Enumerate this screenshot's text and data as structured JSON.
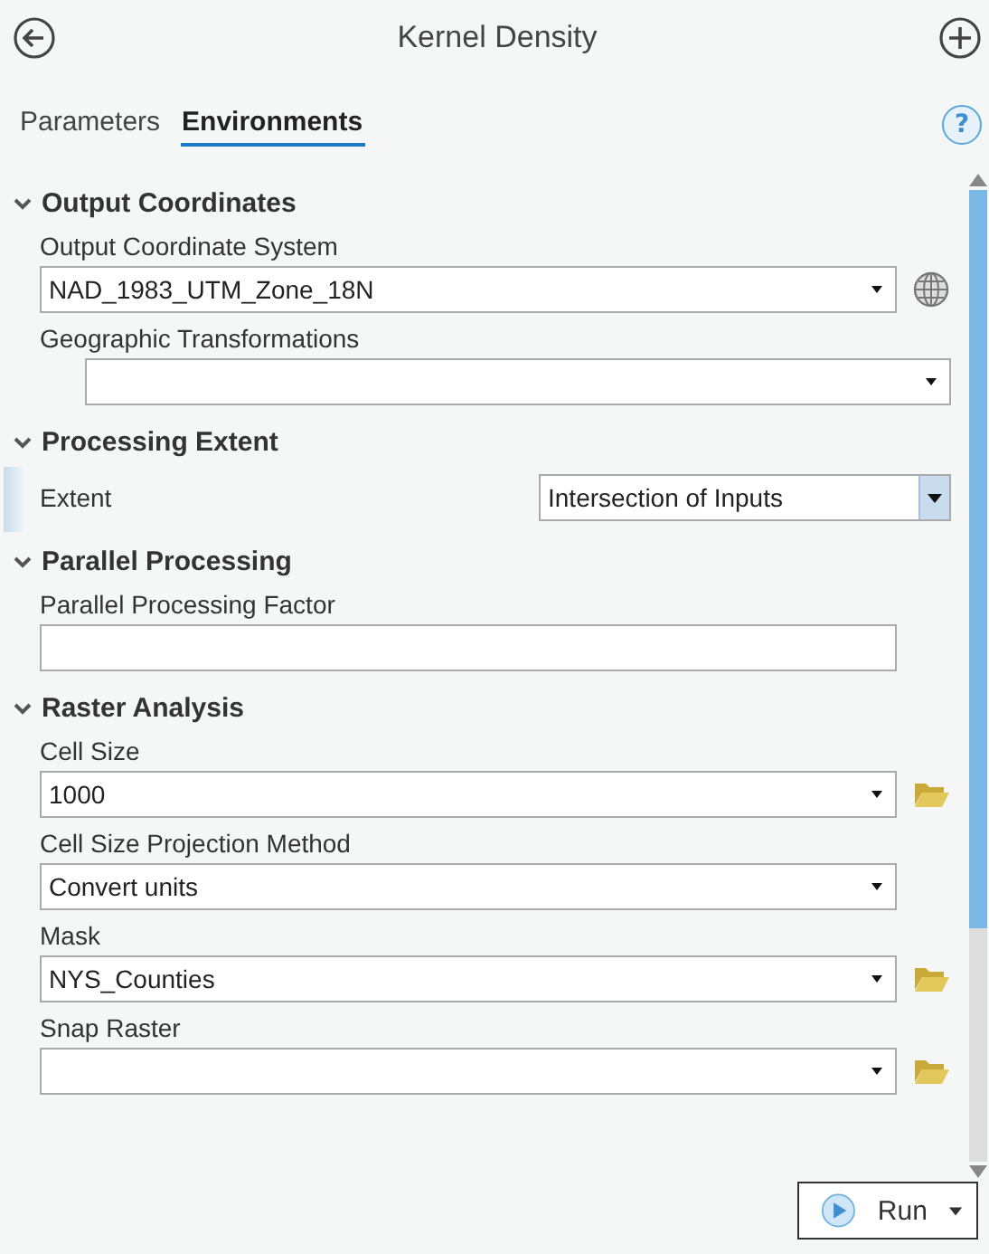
{
  "header": {
    "title": "Kernel Density"
  },
  "tabs": [
    {
      "label": "Parameters",
      "selected": false
    },
    {
      "label": "Environments",
      "selected": true
    }
  ],
  "help": {
    "label": "?"
  },
  "sections": [
    {
      "title": "Output Coordinates",
      "expanded": true,
      "fields": [
        {
          "kind": "globe-dropdown",
          "label": "Output Coordinate System",
          "value": "NAD_1983_UTM_Zone_18N",
          "selected": false
        },
        {
          "kind": "indented-dropdown",
          "label": "Geographic Transformations",
          "selected": false
        }
      ]
    },
    {
      "title": "Processing Extent",
      "expanded": true,
      "fields": [
        {
          "kind": "inline-dropdown",
          "label": "Extent",
          "value": "Intersection of Inputs",
          "selected": true
        }
      ]
    },
    {
      "title": "Parallel Processing",
      "expanded": true,
      "fields": [
        {
          "kind": "text",
          "label": "Parallel Processing Factor",
          "selected": false
        }
      ]
    },
    {
      "title": "Raster Analysis",
      "expanded": true,
      "fields": [
        {
          "kind": "folder-dropdown",
          "label": "Cell Size",
          "value": "1000",
          "selected": false
        },
        {
          "kind": "dropdown",
          "label": "Cell Size Projection Method",
          "value": "Convert units",
          "selected": false
        },
        {
          "kind": "folder-dropdown",
          "label": "Mask",
          "value": "NYS_Counties",
          "selected": false
        },
        {
          "kind": "folder-dropdown",
          "label": "Snap Raster",
          "selected": false
        }
      ]
    }
  ],
  "run_button": {
    "label": "Run"
  }
}
